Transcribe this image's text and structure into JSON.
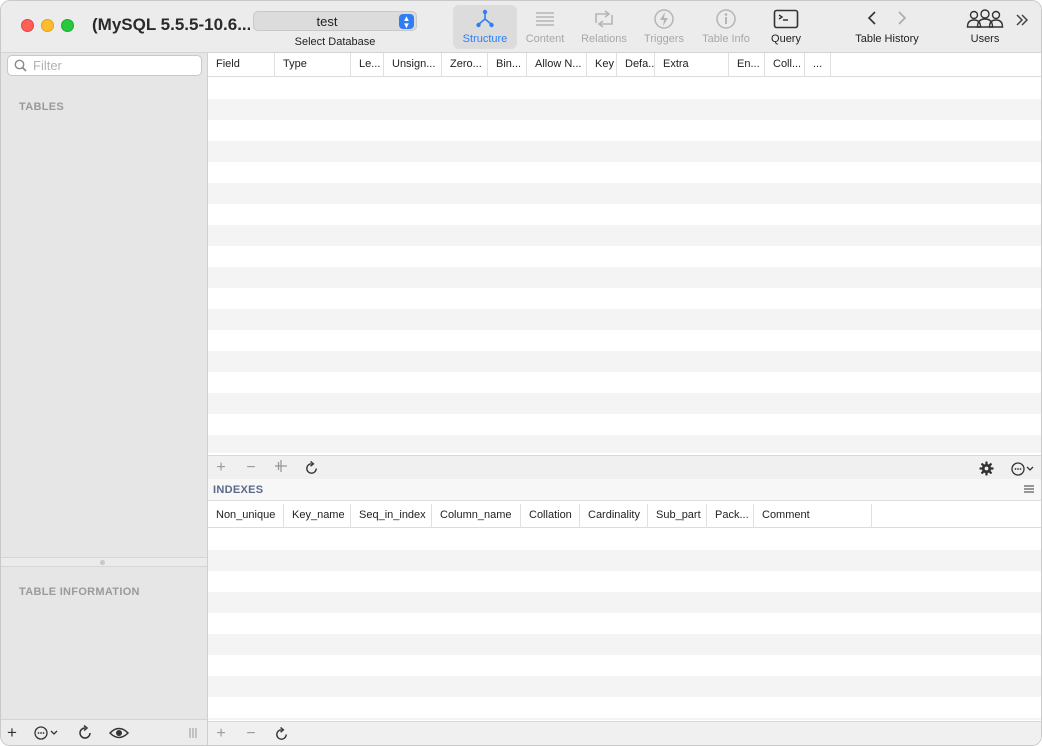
{
  "window": {
    "title": "(MySQL 5.5.5-10.6....",
    "colors": {
      "accent": "#2f7ef6",
      "close": "#ff5f57",
      "minimize": "#febc2e",
      "maximize": "#28c840"
    }
  },
  "toolbar": {
    "database_value": "test",
    "database_label": "Select Database",
    "items": [
      {
        "label": "Structure",
        "icon": "structure-icon",
        "state": "active"
      },
      {
        "label": "Content",
        "icon": "content-icon",
        "state": "disabled"
      },
      {
        "label": "Relations",
        "icon": "relations-icon",
        "state": "disabled"
      },
      {
        "label": "Triggers",
        "icon": "triggers-icon",
        "state": "disabled"
      },
      {
        "label": "Table Info",
        "icon": "info-icon",
        "state": "disabled"
      },
      {
        "label": "Query",
        "icon": "terminal-icon",
        "state": "normal"
      }
    ],
    "history_label": "Table History",
    "users_label": "Users"
  },
  "sidebar": {
    "filter_placeholder": "Filter",
    "tables_heading": "TABLES",
    "info_heading": "TABLE INFORMATION"
  },
  "structure_grid": {
    "columns": [
      "Field",
      "Type",
      "Le...",
      "Unsign...",
      "Zero...",
      "Bin...",
      "Allow N...",
      "Key",
      "Defa...",
      "Extra",
      "En...",
      "Coll...",
      "..."
    ]
  },
  "indexes": {
    "heading": "INDEXES",
    "columns": [
      "Non_unique",
      "Key_name",
      "Seq_in_index",
      "Column_name",
      "Collation",
      "Cardinality",
      "Sub_part",
      "Pack...",
      "Comment"
    ]
  }
}
